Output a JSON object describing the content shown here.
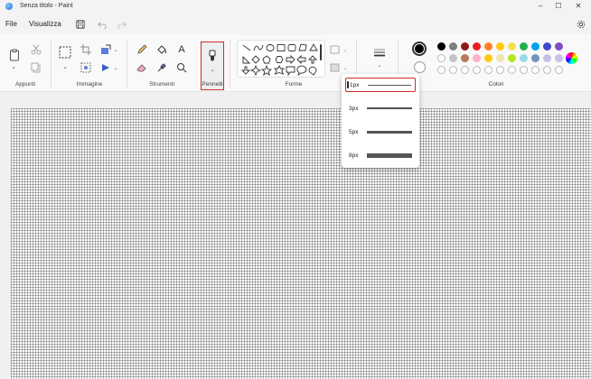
{
  "window": {
    "title": "Senza titolo - Paint",
    "controls": [
      "–",
      "☐",
      "✕"
    ]
  },
  "menu": {
    "file": "File",
    "view": "Visualizza"
  },
  "ribbon": {
    "groups": {
      "clipboard": "Appunti",
      "image": "Immagine",
      "tools": "Strumenti",
      "brushes": "Pennelli",
      "shapes": "Forme",
      "colors": "Colori"
    }
  },
  "brush_size": {
    "options": [
      {
        "label": "1px",
        "thickness": 1,
        "selected": true
      },
      {
        "label": "3px",
        "thickness": 2,
        "selected": false
      },
      {
        "label": "5px",
        "thickness": 3,
        "selected": false
      },
      {
        "label": "8px",
        "thickness": 5,
        "selected": false
      }
    ]
  },
  "colors": {
    "primary": "#000000",
    "secondary": "#ffffff",
    "palette_row1": [
      "#000000",
      "#7f7f7f",
      "#8b1a1a",
      "#ed1c24",
      "#ff7f27",
      "#ffc90e",
      "#f4e04d",
      "#22b14c",
      "#00a2e8",
      "#3f48cc",
      "#7d4fc4"
    ],
    "palette_row2": [
      "#ffffff",
      "#c3c3c3",
      "#b97a57",
      "#ffaec9",
      "#ffc90e",
      "#efe4b0",
      "#b5e61d",
      "#99d9ea",
      "#7092be",
      "#c8bfe7",
      "#c8bfe7"
    ]
  }
}
